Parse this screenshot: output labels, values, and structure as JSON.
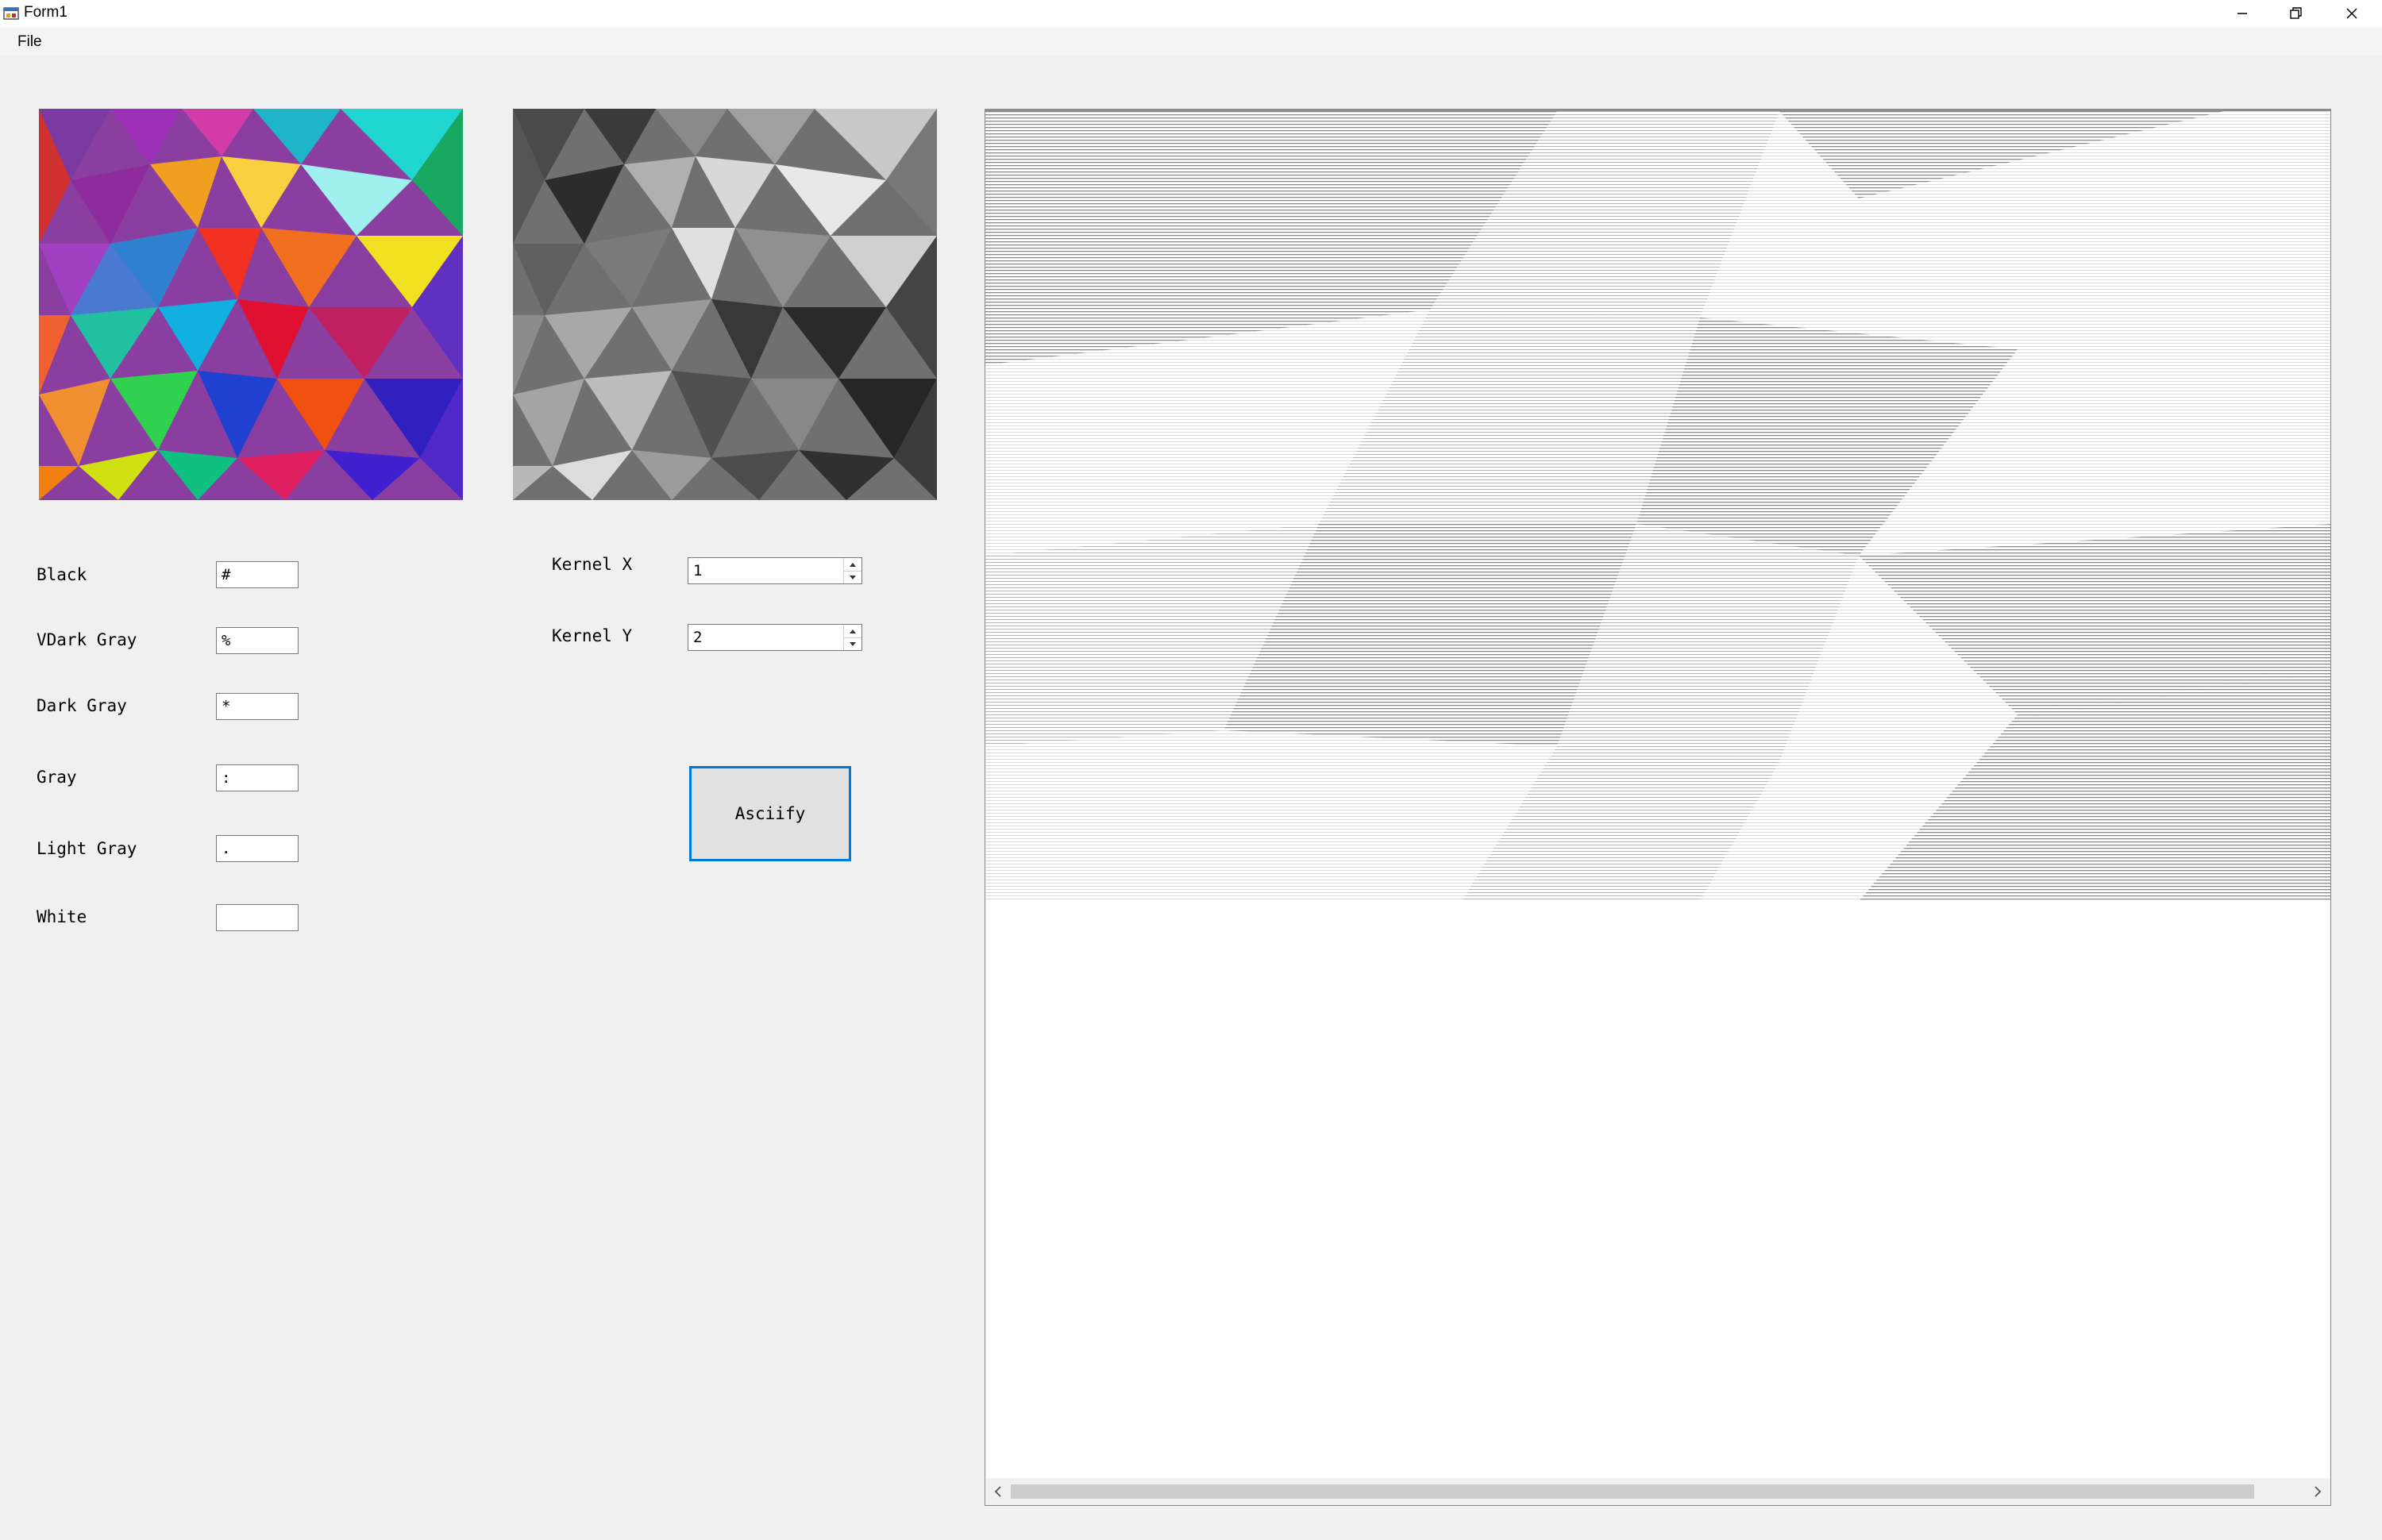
{
  "window": {
    "title": "Form1",
    "controls": [
      "minimize",
      "restore",
      "close"
    ]
  },
  "menu": {
    "items": [
      {
        "label": "File"
      }
    ]
  },
  "images": {
    "original": "colorful low-poly triangles",
    "grayscale": "grayscale low-poly triangles"
  },
  "char_map": [
    {
      "label": "Black",
      "value": "#"
    },
    {
      "label": "VDark Gray",
      "value": "%"
    },
    {
      "label": "Dark Gray",
      "value": "*"
    },
    {
      "label": "Gray",
      "value": ":"
    },
    {
      "label": "Light Gray",
      "value": "."
    },
    {
      "label": "White",
      "value": ""
    }
  ],
  "kernel": {
    "x_label": "Kernel X",
    "x_value": "1",
    "y_label": "Kernel Y",
    "y_value": "2"
  },
  "asciify_button": "Asciify",
  "colors": {
    "accent": "#0078d7",
    "window_bg": "#f0f0f0"
  }
}
